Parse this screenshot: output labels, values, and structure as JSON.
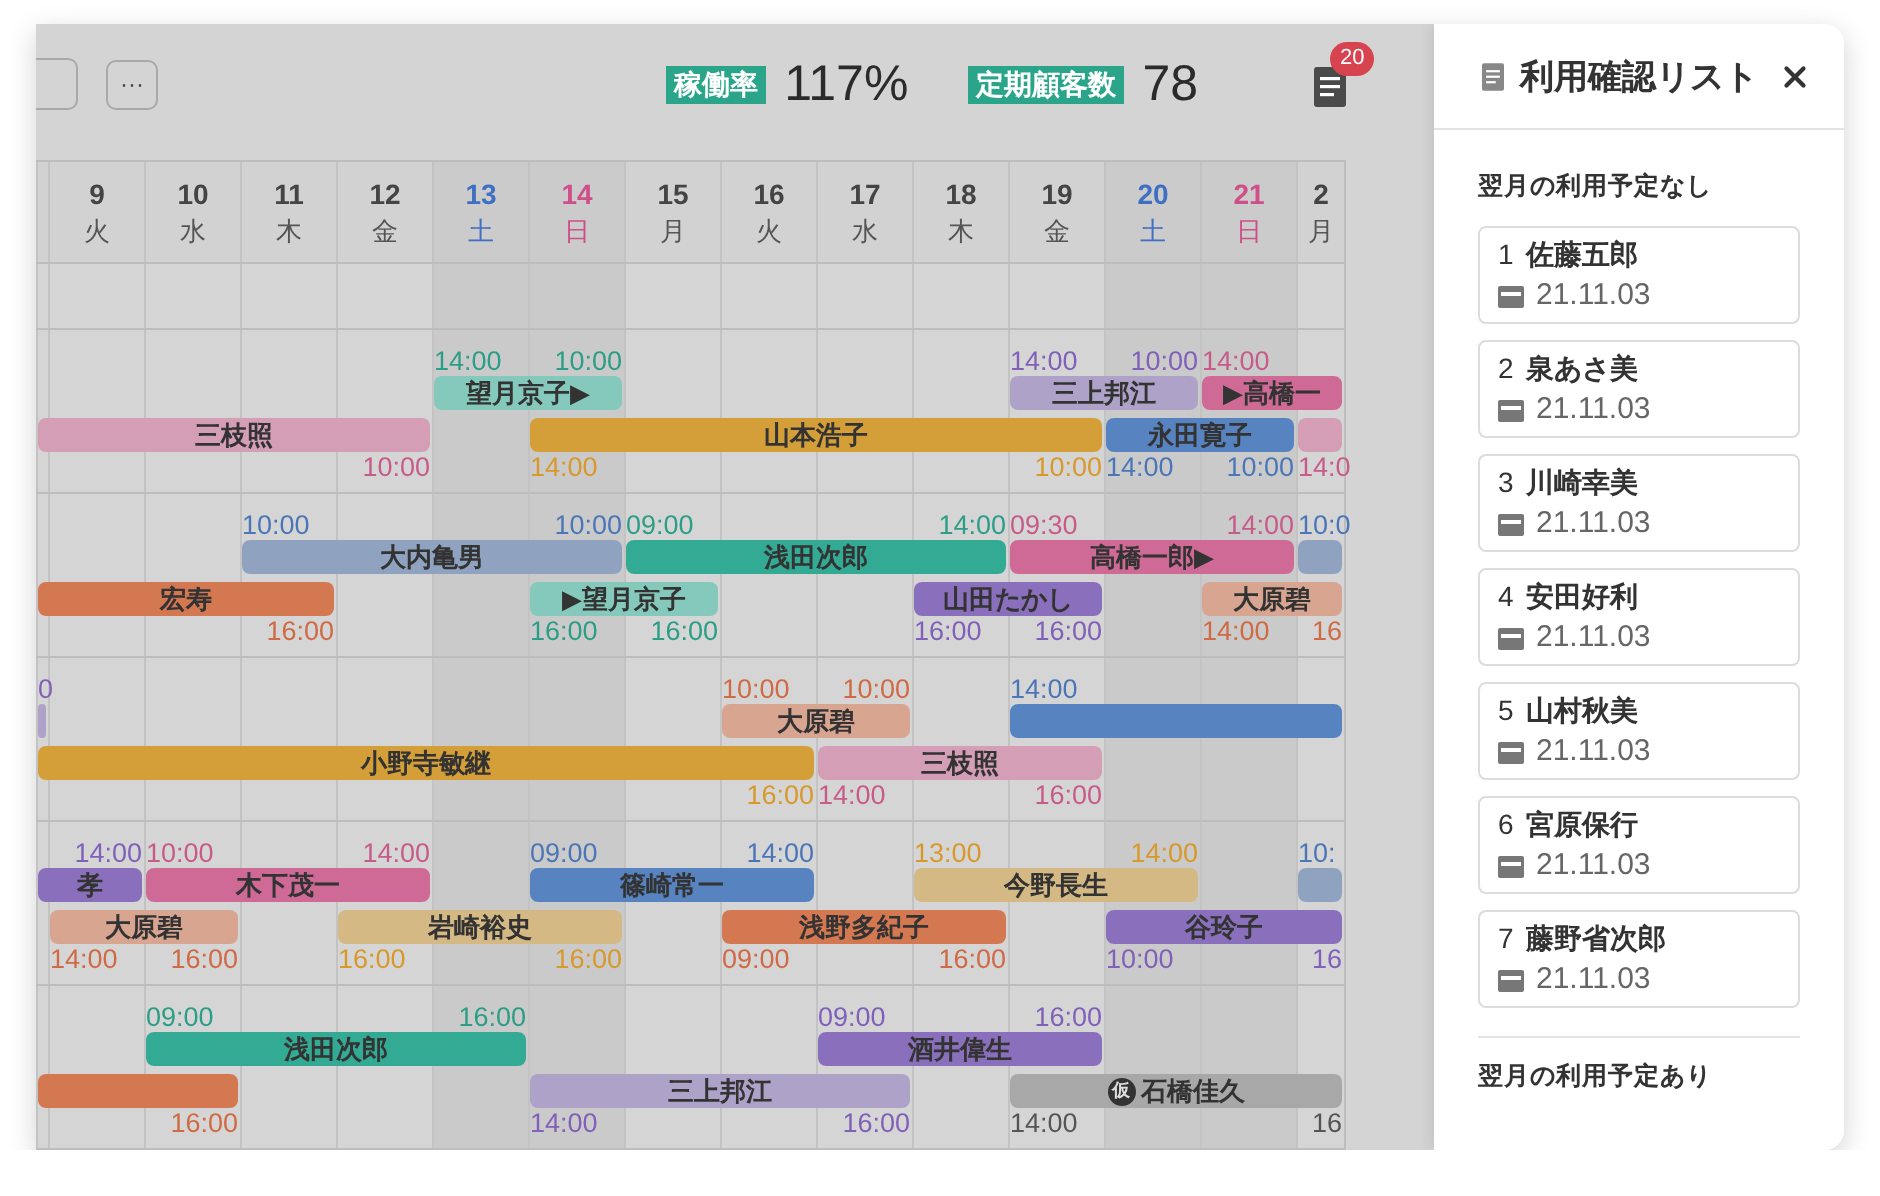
{
  "toolbar": {
    "more_button": "···"
  },
  "stats": [
    {
      "label": "稼働率",
      "value": "117%"
    },
    {
      "label": "定期顧客数",
      "value": "78"
    }
  ],
  "notifications": {
    "count": "20"
  },
  "days": [
    {
      "day": "9",
      "weekday": "火",
      "kind": "weekday"
    },
    {
      "day": "10",
      "weekday": "水",
      "kind": "weekday"
    },
    {
      "day": "11",
      "weekday": "木",
      "kind": "weekday"
    },
    {
      "day": "12",
      "weekday": "金",
      "kind": "weekday"
    },
    {
      "day": "13",
      "weekday": "土",
      "kind": "saturday"
    },
    {
      "day": "14",
      "weekday": "日",
      "kind": "sunday"
    },
    {
      "day": "15",
      "weekday": "月",
      "kind": "weekday"
    },
    {
      "day": "16",
      "weekday": "火",
      "kind": "weekday"
    },
    {
      "day": "17",
      "weekday": "水",
      "kind": "weekday"
    },
    {
      "day": "18",
      "weekday": "木",
      "kind": "weekday"
    },
    {
      "day": "19",
      "weekday": "金",
      "kind": "weekday"
    },
    {
      "day": "20",
      "weekday": "土",
      "kind": "saturday"
    },
    {
      "day": "21",
      "weekday": "日",
      "kind": "sunday"
    },
    {
      "day": "2",
      "weekday": "月",
      "kind": "weekday"
    }
  ],
  "rows": [
    {
      "upper": [
        {
          "name": "望月京子▶",
          "color": "#84c9bb",
          "start": "14:00",
          "end": "10:00"
        },
        {
          "name": "三上邦江",
          "color": "#afa2c9",
          "start": "14:00",
          "end": "10:00"
        },
        {
          "name": "▶高橋一",
          "color": "#cf6a96",
          "start": "14:00"
        }
      ],
      "lower": [
        {
          "name": "三枝照",
          "color": "#d49fb6",
          "end": "10:00"
        },
        {
          "name": "山本浩子",
          "color": "#d49f38",
          "start": "14:00",
          "end": "10:00"
        },
        {
          "name": "永田寛子",
          "color": "#5783c0",
          "start": "14:00",
          "end": "10:00"
        },
        {
          "color": "#d49fb6",
          "start": "14:0"
        }
      ]
    },
    {
      "upper": [
        {
          "name": "大内亀男",
          "color": "#8fa3c0",
          "start": "10:00",
          "end": "10:00"
        },
        {
          "name": "浅田次郎",
          "color": "#33aa94",
          "start": "09:00",
          "end": "14:00"
        },
        {
          "name": "高橋一郎▶",
          "color": "#cf6a96",
          "start": "09:30",
          "end": "14:00"
        },
        {
          "color": "#8fa3c0",
          "start": "10:0"
        }
      ],
      "lower": [
        {
          "name": "宏寿",
          "color": "#d47852",
          "end": "16:00"
        },
        {
          "name": "▶望月京子",
          "color": "#84c9bb",
          "start": "16:00",
          "end": "16:00"
        },
        {
          "name": "山田たかし",
          "color": "#8a70bc",
          "start": "16:00",
          "end": "16:00"
        },
        {
          "name": "大原碧",
          "color": "#d8a591",
          "start": "14:00",
          "end": "16"
        }
      ]
    },
    {
      "upper": [
        {
          "color": "#afa2c9",
          "end": "0"
        },
        {
          "name": "大原碧",
          "color": "#d8a591",
          "start": "10:00",
          "end": "10:00"
        },
        {
          "color": "#5783c0",
          "start": "14:00"
        }
      ],
      "lower": [
        {
          "name": "小野寺敏継",
          "color": "#d49f38",
          "end": "16:00"
        },
        {
          "name": "三枝照",
          "color": "#d49fb6",
          "start": "14:00",
          "end": "16:00"
        }
      ]
    },
    {
      "upper": [
        {
          "name": "孝",
          "color": "#8a70bc",
          "end": "14:00"
        },
        {
          "name": "木下茂一",
          "color": "#cf6a96",
          "start": "10:00",
          "end": "14:00"
        },
        {
          "name": "篠崎常一",
          "color": "#5783c0",
          "start": "09:00",
          "end": "14:00"
        },
        {
          "name": "今野長生",
          "color": "#d5b985",
          "start": "13:00",
          "end": "14:00"
        },
        {
          "color": "#8fa3c0",
          "start": "10:"
        }
      ],
      "lower": [
        {
          "name": "大原碧",
          "color": "#d8a591",
          "start": "14:00",
          "end": "16:00"
        },
        {
          "name": "岩崎裕史",
          "color": "#d5b985",
          "start": "16:00",
          "end": "16:00"
        },
        {
          "name": "浅野多紀子",
          "color": "#d47852",
          "start": "09:00",
          "end": "16:00"
        },
        {
          "name": "谷玲子",
          "color": "#8a70bc",
          "start": "10:00",
          "end": "16"
        }
      ]
    },
    {
      "upper": [
        {
          "name": "浅田次郎",
          "color": "#33aa94",
          "start": "09:00",
          "end": "16:00"
        },
        {
          "name": "酒井偉生",
          "color": "#8a70bc",
          "start": "09:00",
          "end": "16:00"
        }
      ],
      "lower": [
        {
          "color": "#d47852",
          "end": "16:00"
        },
        {
          "name": "三上邦江",
          "color": "#afa2c9",
          "start": "14:00",
          "end": "16:00"
        },
        {
          "name": "石橋佳久",
          "badge": "仮",
          "color": "#a8a8a8",
          "start": "14:00",
          "end": "16"
        }
      ]
    }
  ],
  "panel": {
    "title": "利用確認リスト",
    "sections": [
      {
        "label": "翌月の利用予定なし",
        "items": [
          {
            "number": "1",
            "name": "佐藤五郎",
            "date": "21.11.03"
          },
          {
            "number": "2",
            "name": "泉あさ美",
            "date": "21.11.03"
          },
          {
            "number": "3",
            "name": "川崎幸美",
            "date": "21.11.03"
          },
          {
            "number": "4",
            "name": "安田好利",
            "date": "21.11.03"
          },
          {
            "number": "5",
            "name": "山村秋美",
            "date": "21.11.03"
          },
          {
            "number": "6",
            "name": "宮原保行",
            "date": "21.11.03"
          },
          {
            "number": "7",
            "name": "藤野省次郎",
            "date": "21.11.03"
          }
        ]
      },
      {
        "label": "翌月の利用予定あり"
      }
    ]
  }
}
